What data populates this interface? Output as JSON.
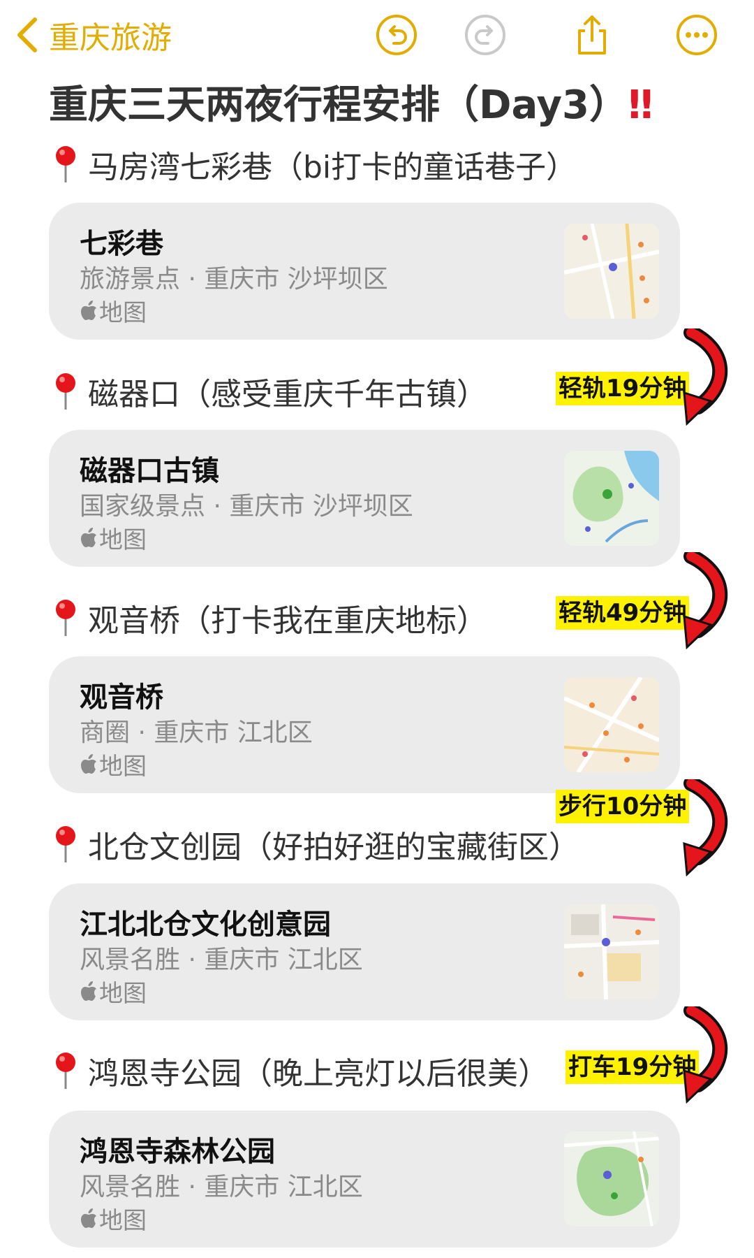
{
  "toolbar": {
    "back_label": "重庆旅游",
    "icons": [
      "undo-icon",
      "redo-icon",
      "share-icon",
      "more-icon"
    ],
    "accent": "#e2ac00"
  },
  "page": {
    "title": "重庆三天两夜行程安排（Day3）",
    "title_mark": "‼"
  },
  "sections": [
    {
      "heading": "马房湾七彩巷（bi打卡的童话巷子）",
      "card": {
        "title": "七彩巷",
        "subtitle": "旅游景点 · 重庆市 沙坪坝区",
        "source": "地图"
      }
    },
    {
      "heading": "磁器口（感受重庆千年古镇）",
      "transit": "轻轨19分钟",
      "card": {
        "title": "磁器口古镇",
        "subtitle": "国家级景点 · 重庆市 沙坪坝区",
        "source": "地图"
      }
    },
    {
      "heading": "观音桥（打卡我在重庆地标）",
      "transit": "轻轨49分钟",
      "card": {
        "title": "观音桥",
        "subtitle": "商圈 · 重庆市 江北区",
        "source": "地图"
      }
    },
    {
      "heading": "北仓文创园（好拍好逛的宝藏街区）",
      "transit": "步行10分钟",
      "card": {
        "title": "江北北仓文化创意园",
        "subtitle": "风景名胜 · 重庆市 江北区",
        "source": "地图"
      }
    },
    {
      "heading": "鸿恩寺公园（晚上亮灯以后很美）",
      "transit": "打车19分钟",
      "card": {
        "title": "鸿恩寺森林公园",
        "subtitle": "风景名胜 · 重庆市 江北区",
        "source": "地图"
      }
    }
  ],
  "colors": {
    "badge_yellow": "#fff200",
    "arrow_red": "#e5161b",
    "card_bg": "#ebebeb",
    "secondary_text": "#8a8a8a"
  }
}
